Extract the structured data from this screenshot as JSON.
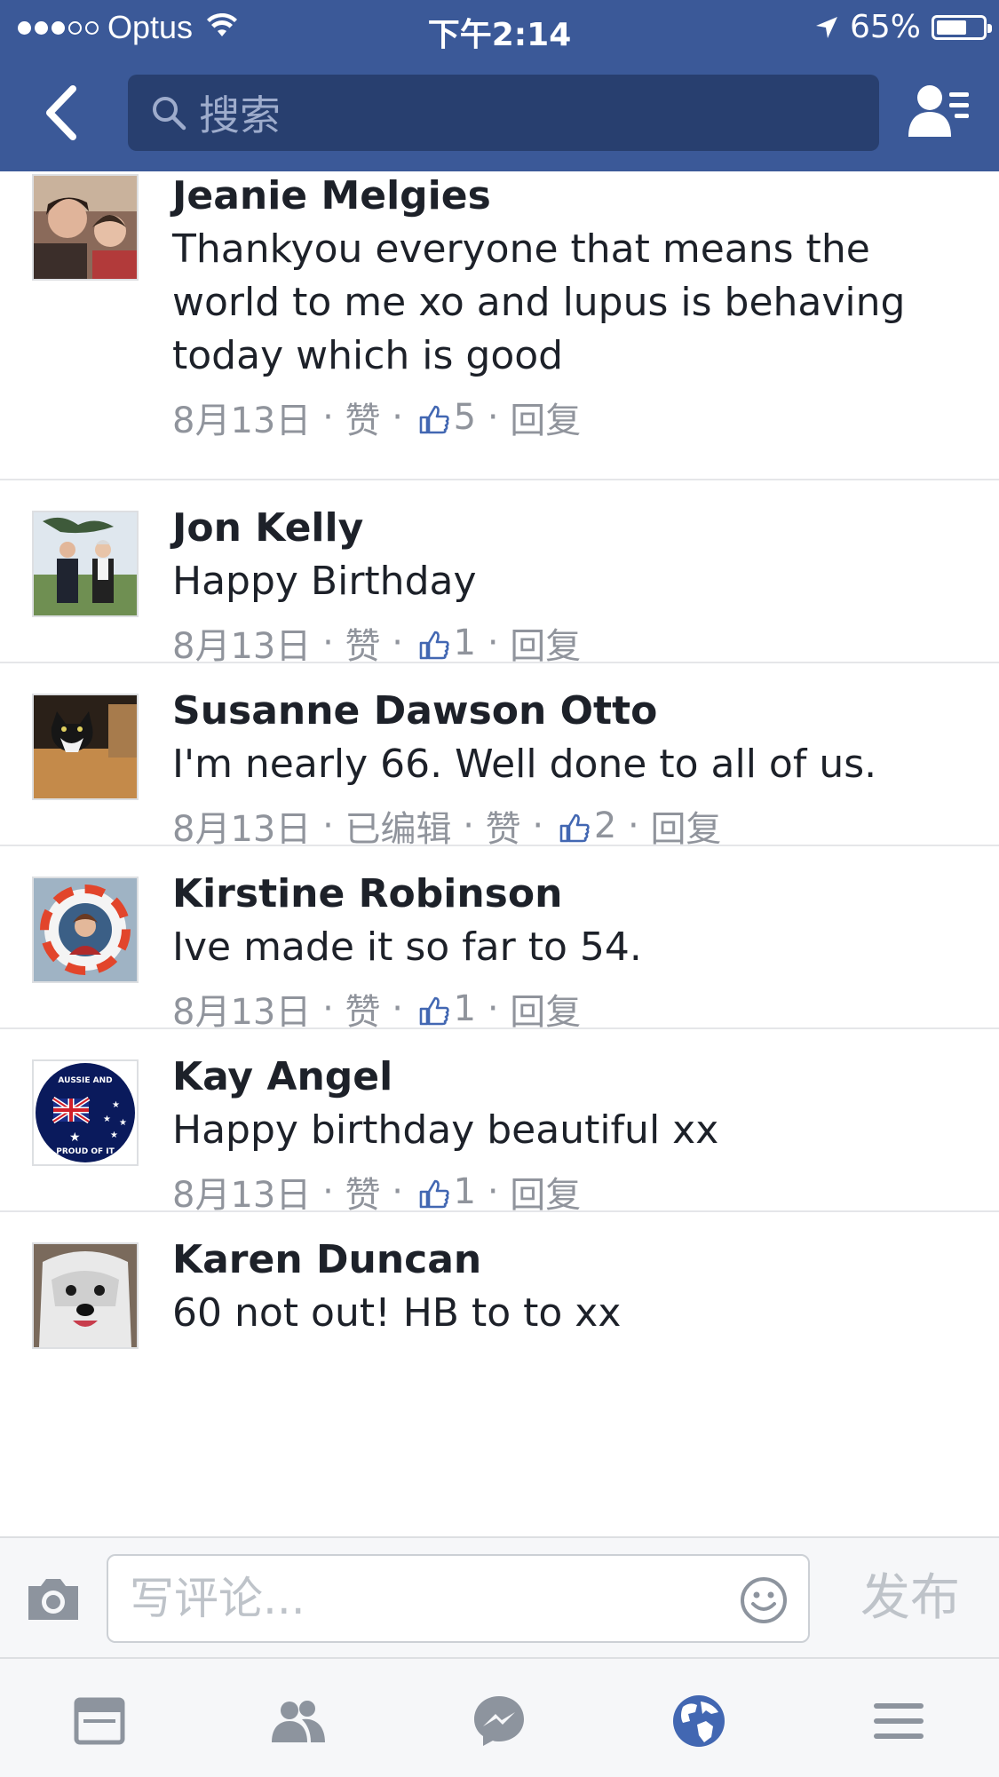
{
  "status_bar": {
    "carrier": "Optus",
    "time": "下午2:14",
    "battery": "65%",
    "battery_level": 0.65
  },
  "nav": {
    "search_placeholder": "搜索",
    "back_icon": "chevron-left-icon",
    "friends_icon": "friend-requests-icon"
  },
  "comments": [
    {
      "name": "Jeanie Melgies",
      "text": "Thankyou everyone that means the world to me xo and lupus is behaving today which is good",
      "date": "8月13日",
      "edited": "",
      "like": "赞",
      "likes": "5",
      "reply": "回复"
    },
    {
      "name": "Jon Kelly",
      "text": "Happy Birthday",
      "date": "8月13日",
      "edited": "",
      "like": "赞",
      "likes": "1",
      "reply": "回复"
    },
    {
      "name": "Susanne Dawson Otto",
      "text": "I'm nearly 66. Well done to all of us.",
      "date": "8月13日",
      "edited": "已编辑",
      "like": "赞",
      "likes": "2",
      "reply": "回复"
    },
    {
      "name": "Kirstine Robinson",
      "text": "Ive made it so far to 54.",
      "date": "8月13日",
      "edited": "",
      "like": "赞",
      "likes": "1",
      "reply": "回复"
    },
    {
      "name": "Kay Angel",
      "text": "Happy birthday beautiful xx",
      "date": "8月13日",
      "edited": "",
      "like": "赞",
      "likes": "1",
      "reply": "回复",
      "avatar_badge_top": "AUSSIE AND",
      "avatar_badge_bottom": "PROUD OF IT"
    },
    {
      "name": "Karen Duncan",
      "text": "60 not out! HB to to xx",
      "date": "",
      "edited": "",
      "like": "",
      "likes": "",
      "reply": ""
    }
  ],
  "composer": {
    "placeholder": "写评论...",
    "post_label": "发布"
  },
  "tabs": [
    {
      "name": "news-feed-icon"
    },
    {
      "name": "friends-icon"
    },
    {
      "name": "messenger-icon"
    },
    {
      "name": "notifications-globe-icon",
      "active": true
    },
    {
      "name": "menu-icon"
    }
  ],
  "colors": {
    "brand": "#3b5998",
    "search_bg": "#283f6f",
    "meta_text": "#90949c",
    "active_tab": "#4267b2"
  }
}
